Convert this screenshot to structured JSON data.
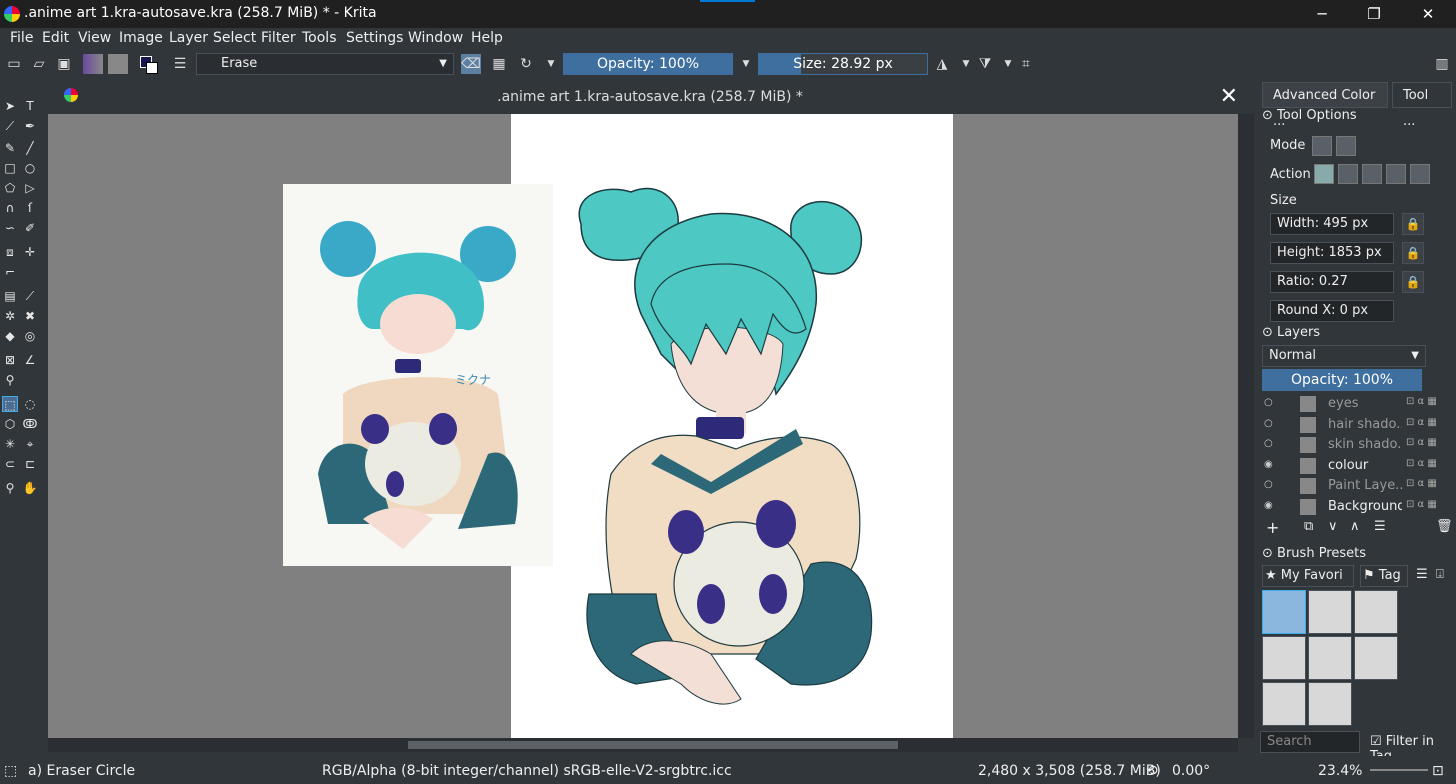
{
  "window": {
    "title": ".anime art 1.kra-autosave.kra (258.7 MiB) * - Krita",
    "min_glyph": "─",
    "restore_glyph": "❐",
    "close_glyph": "✕"
  },
  "menu": [
    "File",
    "Edit",
    "View",
    "Image",
    "Layer",
    "Select",
    "Filter",
    "Tools",
    "Settings",
    "Window",
    "Help"
  ],
  "toolbar": {
    "brush_preset": "Erase",
    "opacity": {
      "label": "Opacity: 100%",
      "value": 1.0
    },
    "size": {
      "label": "Size: 28.92 px",
      "value": 0.25
    }
  },
  "document": {
    "title": ".anime art 1.kra-autosave.kra (258.7 MiB) *",
    "close_glyph": "✕"
  },
  "dock_tabs": [
    "Advanced Color ...",
    "Tool ..."
  ],
  "tool_options": {
    "header": "Tool Options",
    "mode_label": "Mode",
    "action_label": "Action",
    "size_label": "Size",
    "width": "Width: 495 px",
    "height": "Height: 1853 px",
    "ratio": "Ratio: 0.27",
    "round_x": "Round X: 0 px"
  },
  "layers": {
    "header": "Layers",
    "blend_mode": "Normal",
    "opacity": {
      "label": "Opacity:  100%",
      "value": 1.0
    },
    "items": [
      {
        "name": "eyes",
        "visible": false
      },
      {
        "name": "hair shado...",
        "visible": false
      },
      {
        "name": "skin shado...",
        "visible": false
      },
      {
        "name": "colour",
        "visible": true
      },
      {
        "name": "Paint Laye...",
        "visible": false
      },
      {
        "name": "Background",
        "visible": true
      }
    ]
  },
  "brush_presets": {
    "header": "Brush Presets",
    "filter": "My Favori",
    "tag": "Tag",
    "search_placeholder": "Search",
    "filter_in_tag": "Filter in Tag"
  },
  "status": {
    "tool": "a) Eraser Circle",
    "color_profile": "RGB/Alpha (8-bit integer/channel)  sRGB-elle-V2-srgbtrc.icc",
    "dimensions": "2,480 x 3,508 (258.7 MiB)",
    "rotation": "0.00°",
    "zoom": "23.4%"
  }
}
